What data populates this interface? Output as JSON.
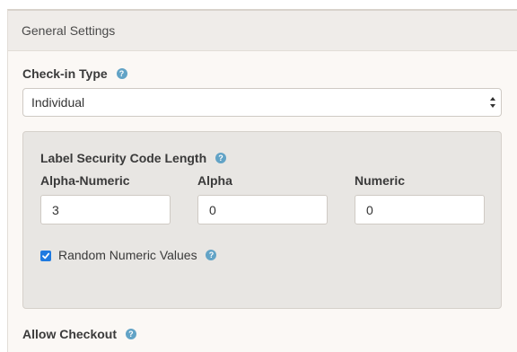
{
  "panel": {
    "title": "General Settings"
  },
  "checkin_type": {
    "label": "Check-in Type",
    "selected_value": "Individual"
  },
  "security_code": {
    "title": "Label Security Code Length",
    "alpha_numeric": {
      "label": "Alpha-Numeric",
      "value": "3"
    },
    "alpha": {
      "label": "Alpha",
      "value": "0"
    },
    "numeric": {
      "label": "Numeric",
      "value": "0"
    },
    "random_numeric": {
      "label": "Random Numeric Values",
      "checked": true
    }
  },
  "next_field": {
    "label": "Allow Checkout"
  },
  "icons": {
    "help": "question-circle-icon",
    "select": "select-arrows-icon",
    "check": "checkmark-icon"
  },
  "colors": {
    "accent": "#62a3c6",
    "checkbox": "#1f7ae0",
    "panel_bg": "#fbf8f5",
    "heading_bg": "#efece9",
    "well_bg": "#e8e6e3"
  }
}
